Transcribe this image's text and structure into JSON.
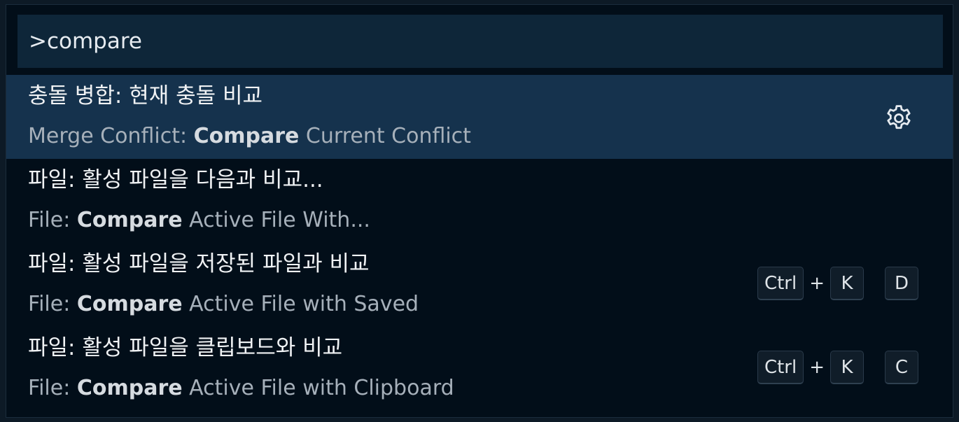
{
  "search": {
    "value": ">compare"
  },
  "items": [
    {
      "label": "충돌 병합: 현재 충돌 비교",
      "detail_prefix": "Merge Conflict: ",
      "detail_match": "Compare",
      "detail_suffix": " Current Conflict",
      "selected": true,
      "action_icon": "gear-icon"
    },
    {
      "label": "파일: 활성 파일을 다음과 비교...",
      "detail_prefix": "File: ",
      "detail_match": "Compare",
      "detail_suffix": " Active File With..."
    },
    {
      "label": "파일: 활성 파일을 저장된 파일과 비교",
      "detail_prefix": "File: ",
      "detail_match": "Compare",
      "detail_suffix": " Active File with Saved",
      "keybinding": {
        "k1": "Ctrl",
        "plus": "+",
        "k2": "K",
        "k3": "D"
      }
    },
    {
      "label": "파일: 활성 파일을 클립보드와 비교",
      "detail_prefix": "File: ",
      "detail_match": "Compare",
      "detail_suffix": " Active File with Clipboard",
      "keybinding": {
        "k1": "Ctrl",
        "plus": "+",
        "k2": "K",
        "k3": "C"
      }
    }
  ],
  "colors": {
    "background": "#020e19",
    "input_background": "#0e2639",
    "selected_row": "#15324d"
  }
}
